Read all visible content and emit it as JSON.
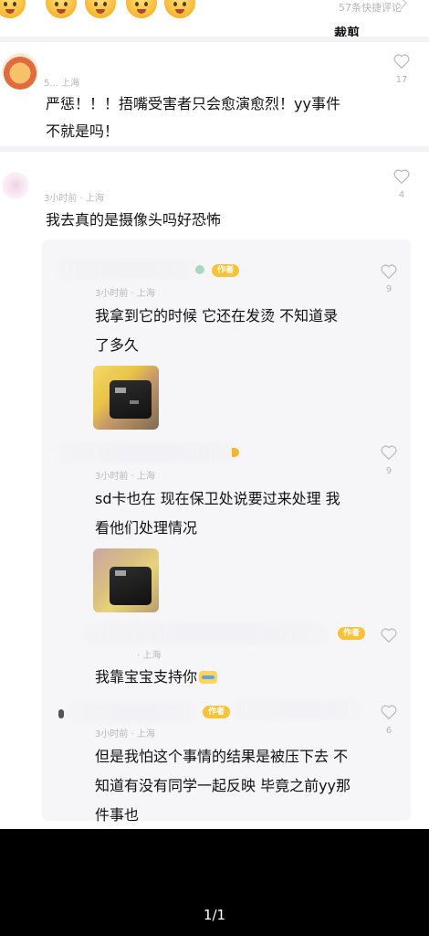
{
  "top": {
    "quick_comment": "57条快捷评论",
    "crop_label": "裁剪"
  },
  "comments": [
    {
      "meta": "5...  上海",
      "text_line1": "严惩！！！捂嘴受害者只会愈演愈烈！yy事件",
      "text_line2": "不就是吗！",
      "likes": "17"
    },
    {
      "meta": "3小时前 · 上海",
      "text_line1": "我去真的是摄像头吗好恐怖",
      "likes": "4"
    }
  ],
  "replies": [
    {
      "badge": "作者",
      "meta": "3小时前 · 上海",
      "text_line1": "我拿到它的时候 它还在发烫 不知道录",
      "text_line2": "了多久",
      "likes": "9",
      "has_photo": true
    },
    {
      "meta": "3小时前 · 上海",
      "text_line1": "sd卡也在 现在保卫处说要过来处理 我",
      "text_line2": "看他们处理情况",
      "likes": "9",
      "has_photo": true
    },
    {
      "badge": "作者",
      "meta": "· 上海",
      "text_line1": "我靠宝宝支持你",
      "likes": ""
    },
    {
      "badge": "作者",
      "meta": "3小时前 · 上海",
      "text_line1": "但是我怕这个事情的结果是被压下去 不",
      "text_line2": "知道有没有同学一起反映 毕竟之前yy那",
      "text_line3": "件事也",
      "likes": "6"
    }
  ],
  "viewer": {
    "pager": "1/1"
  },
  "colors": {
    "author_badge": "#f8c23a",
    "background": "#ffffff",
    "reply_panel": "#f6f6f8",
    "bottom_bar": "#000000"
  }
}
